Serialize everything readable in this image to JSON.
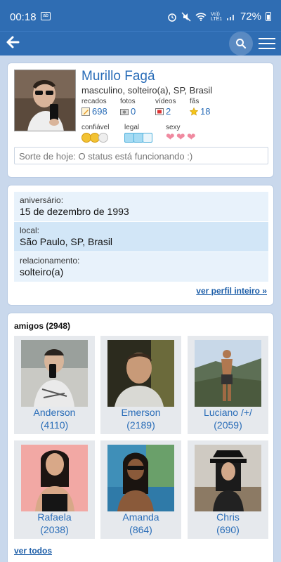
{
  "statusbar": {
    "time": "00:18",
    "notif_badge": "ab",
    "network": "Vo)) LTE1",
    "battery": "72%"
  },
  "profile": {
    "name": "Murillo Fagá",
    "subtitle": "masculino, solteiro(a), SP, Brasil",
    "stats": [
      {
        "label": "recados",
        "value": "698",
        "icon": "pencil-icon"
      },
      {
        "label": "fotos",
        "value": "0",
        "icon": "camera-icon"
      },
      {
        "label": "vídeos",
        "value": "2",
        "icon": "film-icon"
      },
      {
        "label": "fãs",
        "value": "18",
        "icon": "star-icon"
      }
    ],
    "ratings": [
      {
        "label": "confiável",
        "filled": 2,
        "max": 3
      },
      {
        "label": "legal",
        "filled": 2,
        "max": 3
      },
      {
        "label": "sexy",
        "filled": 3,
        "max": 3
      }
    ],
    "status_text": "Sorte de hoje: O status está funcionando :)"
  },
  "info": {
    "birthday_label": "aniversário:",
    "birthday_value": "15 de dezembro de 1993",
    "location_label": "local:",
    "location_value": "São Paulo, SP, Brasil",
    "relationship_label": "relacionamento:",
    "relationship_value": "solteiro(a)",
    "more_link": "ver perfil inteiro »"
  },
  "friends": {
    "title": "amigos (2948)",
    "items": [
      {
        "name": "Anderson",
        "count": "(4110)"
      },
      {
        "name": "Emerson",
        "count": "(2189)"
      },
      {
        "name": "Luciano /+/",
        "count": "(2059)"
      },
      {
        "name": "Rafaela",
        "count": "(2038)"
      },
      {
        "name": "Amanda",
        "count": "(864)"
      },
      {
        "name": "Chris",
        "count": "(690)"
      }
    ],
    "see_all": "ver todos"
  },
  "colors": {
    "bar": "#2f6db3",
    "link": "#2a6db8",
    "background": "#c9d8ec"
  }
}
